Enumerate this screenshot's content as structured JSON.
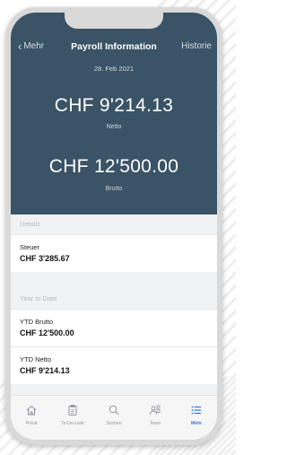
{
  "header": {
    "back_label": "Mehr",
    "title": "Payroll Information",
    "history_label": "Historie",
    "date": "28. Feb 2021"
  },
  "summary": {
    "netto_amount": "CHF 9'214.13",
    "netto_label": "Netto",
    "brutto_amount": "CHF 12'500.00",
    "brutto_label": "Brutto"
  },
  "details": {
    "section_title": "Details",
    "steuer_label": "Steuer",
    "steuer_value": "CHF 3'285.67"
  },
  "ytd": {
    "section_title": "Year to Date",
    "brutto_label": "YTD Brutto",
    "brutto_value": "CHF 12'500.00",
    "netto_label": "YTD Netto",
    "netto_value": "CHF 9'214.13"
  },
  "tabbar": {
    "items": [
      {
        "label": "Privat",
        "icon": "home-icon"
      },
      {
        "label": "To-Do-Liste",
        "icon": "clipboard-icon"
      },
      {
        "label": "Suchen",
        "icon": "search-icon"
      },
      {
        "label": "Team",
        "icon": "team-icon"
      },
      {
        "label": "Mehr",
        "icon": "list-icon"
      }
    ],
    "active_index": 4
  },
  "colors": {
    "header_bg": "#3a5366",
    "accent": "#2f7ce0"
  }
}
